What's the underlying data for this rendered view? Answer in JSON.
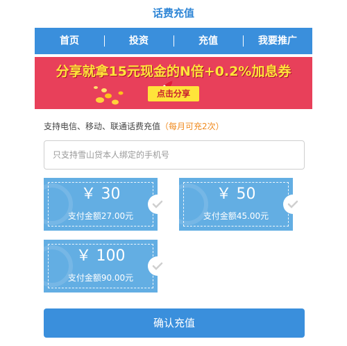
{
  "header": {
    "title": "话费充值"
  },
  "nav": {
    "items": [
      {
        "label": "首页"
      },
      {
        "label": "投资"
      },
      {
        "label": "充值"
      },
      {
        "label": "我要推广"
      }
    ]
  },
  "banner": {
    "headline": "分享就拿15元现金的N倍+0.2%加息券",
    "button_label": "点击分享"
  },
  "support": {
    "text": "支持电信、移动、联通话费充值",
    "note": "（每月可充2次）"
  },
  "phone_input": {
    "placeholder": "只支持雪山贷本人绑定的手机号",
    "value": ""
  },
  "cards": [
    {
      "amount": "￥ 30",
      "pay": "支付金额27.00元"
    },
    {
      "amount": "￥ 50",
      "pay": "支付金额45.00元"
    },
    {
      "amount": "￥ 100",
      "pay": "支付金额90.00元"
    }
  ],
  "confirm": {
    "label": "确认充值"
  },
  "colors": {
    "accent": "#3a8fdc",
    "banner_bg": "#e8405a",
    "banner_text": "#ffe43a",
    "card_bg": "#63aee3",
    "note": "#f08a1e"
  },
  "icons": [
    "coins-icon",
    "rocket-icon",
    "check-icon"
  ]
}
